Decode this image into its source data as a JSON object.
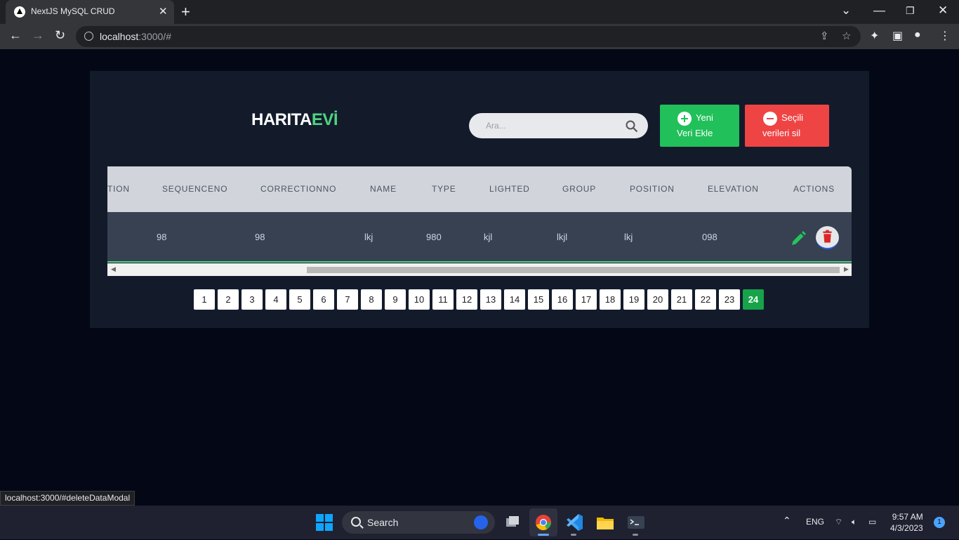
{
  "browser": {
    "tab_title": "NextJS MySQL CRUD",
    "url_host": "localhost",
    "url_rest": ":3000/#",
    "status_url": "localhost:3000/#deleteDataModal"
  },
  "app": {
    "brand_main": "HARITA",
    "brand_accent": "EVİ",
    "search_placeholder": "Ara...",
    "add_button": {
      "line1": "Yeni",
      "line2": "Veri Ekle"
    },
    "delete_button": {
      "line1": "Seçili",
      "line2": "verileri sil"
    },
    "table": {
      "headers": [
        "TION",
        "SEQUENCENO",
        "CORRECTIONNO",
        "NAME",
        "TYPE",
        "LIGHTED",
        "GROUP",
        "POSITION",
        "ELEVATION",
        "ACTIONS"
      ],
      "row": [
        "98",
        "98",
        "lkj",
        "980",
        "kjl",
        "lkjl",
        "lkj",
        "098"
      ]
    },
    "pages": [
      "1",
      "2",
      "3",
      "4",
      "5",
      "6",
      "7",
      "8",
      "9",
      "10",
      "11",
      "12",
      "13",
      "14",
      "15",
      "16",
      "17",
      "18",
      "19",
      "20",
      "21",
      "22",
      "23",
      "24"
    ],
    "active_page": "24"
  },
  "taskbar": {
    "search_label": "Search",
    "language": "ENG",
    "time": "9:57 AM",
    "date": "4/3/2023",
    "notification_count": "1"
  },
  "colors": {
    "accent_green": "#21c05a",
    "danger_red": "#ef4444",
    "brand_accent": "#4ed480",
    "active_page": "#16a34a"
  },
  "icons": [
    "search-icon",
    "plus-circle-icon",
    "minus-circle-icon",
    "pencil-icon",
    "trash-icon"
  ]
}
